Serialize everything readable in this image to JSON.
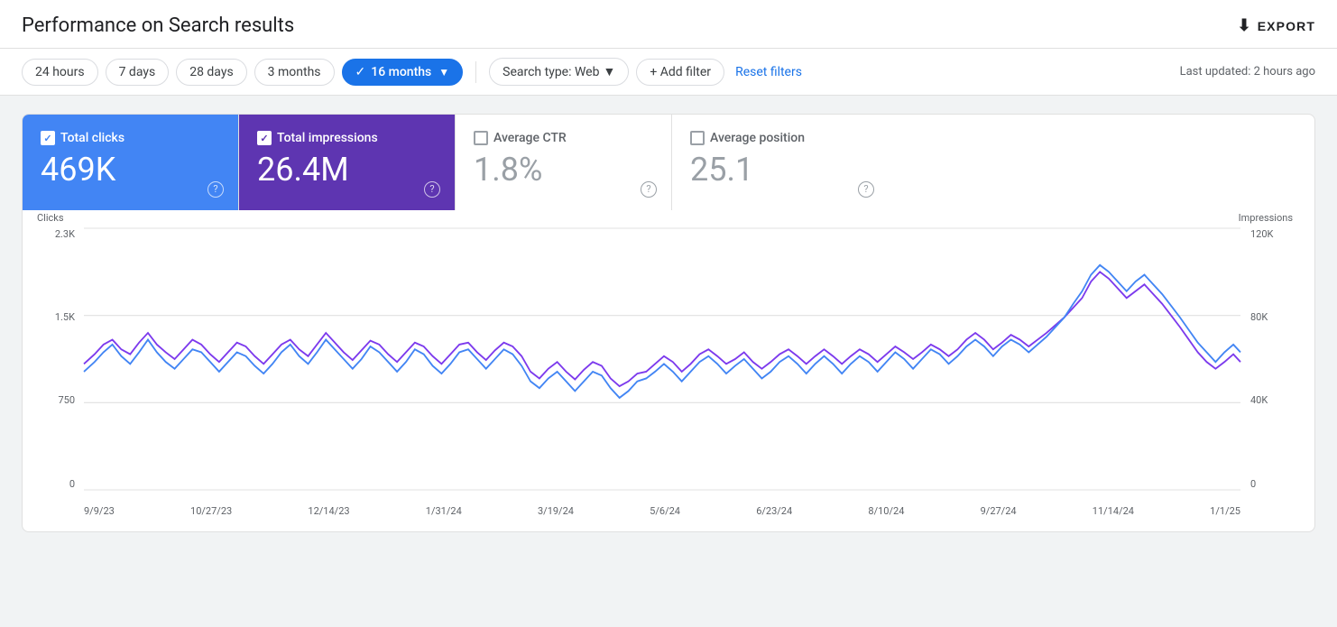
{
  "header": {
    "title": "Performance on Search results",
    "export_label": "EXPORT"
  },
  "toolbar": {
    "time_buttons": [
      {
        "label": "24 hours",
        "id": "24h",
        "active": false
      },
      {
        "label": "7 days",
        "id": "7d",
        "active": false
      },
      {
        "label": "28 days",
        "id": "28d",
        "active": false
      },
      {
        "label": "3 months",
        "id": "3m",
        "active": false
      },
      {
        "label": "16 months",
        "id": "16m",
        "active": true
      }
    ],
    "search_type_label": "Search type: Web",
    "add_filter_label": "+ Add filter",
    "reset_filters_label": "Reset filters",
    "last_updated": "Last updated: 2 hours ago"
  },
  "metrics": [
    {
      "id": "total-clicks",
      "label": "Total clicks",
      "value": "469K",
      "active": true,
      "type": "clicks"
    },
    {
      "id": "total-impressions",
      "label": "Total impressions",
      "value": "26.4M",
      "active": true,
      "type": "impressions"
    },
    {
      "id": "average-ctr",
      "label": "Average CTR",
      "value": "1.8%",
      "active": false,
      "type": "ctr"
    },
    {
      "id": "average-position",
      "label": "Average position",
      "value": "25.1",
      "active": false,
      "type": "position"
    }
  ],
  "chart": {
    "left_axis_title": "Clicks",
    "right_axis_title": "Impressions",
    "left_axis_labels": [
      "2.3K",
      "1.5K",
      "750",
      "0"
    ],
    "right_axis_labels": [
      "120K",
      "80K",
      "40K",
      "0"
    ],
    "x_labels": [
      "9/9/23",
      "10/27/23",
      "12/14/23",
      "1/31/24",
      "3/19/24",
      "5/6/24",
      "6/23/24",
      "8/10/24",
      "9/27/24",
      "11/14/24",
      "1/1/25"
    ],
    "clicks_color": "#4285f4",
    "impressions_color": "#7c3aed"
  }
}
